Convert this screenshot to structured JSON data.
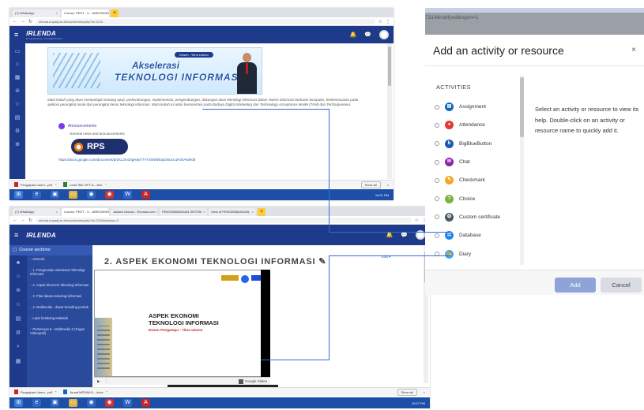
{
  "shot1": {
    "tabs": [
      {
        "label": "(7) WhatsApp"
      },
      {
        "label": "Course: PEET - 3 - JARKOMINT"
      }
    ],
    "url": "elenda.unpadj.ac.id/course/view.php?id=1234",
    "brand": "IRLENDA",
    "brand_sub": "E-LEARNING UNIVERSITAS",
    "banner": {
      "pill": "Dosen : Yitno Utomo",
      "line1": "Akselerasi",
      "line2": "TEKNOLOGI INFORMASI"
    },
    "description": "Mata kuliah yang akan mempelajari tentang awal, perkembangan, implementasi, pengembangan, dukungan akan teknologi informasi dalam sistem informasi berbasis komputer, berkesesuaian pada aplikasi perangkat lunak dan perangkat keras teknologi informasi. Mata kuliah ini akan berorientasi pada Budaya Digital Marketing dan Technology Acceptance Model (TAM) dan Technopreneur.",
    "announcements": "Announcements",
    "general": "General news and announcements",
    "rps": "RPS",
    "doc_link": "https://docs.google.com/document/d/1KL2m1hgHdyT7YVOWWb3pGkUoc1P2hAN/edit",
    "downloads": [
      {
        "label": "Pengajuan Usern...pdf"
      },
      {
        "label": "Lead Title UPT-IL...xlsx"
      }
    ],
    "show_all": "Show all",
    "clock": "10:01 PM"
  },
  "shot2": {
    "tabs": [
      {
        "label": "(7) WhatsApp"
      },
      {
        "label": "Course: PEET - 3 - JARKOMINT"
      },
      {
        "label": "Jadwal Liburan - Revalos.com"
      },
      {
        "label": "PENGEMBANGAN SISTEM"
      },
      {
        "label": "View of PENGEMBANGAN"
      }
    ],
    "url": "elenda.unpadj.ac.id/course/view.php?id=1234&section=2",
    "brand": "IRLENDA",
    "sidebar_head": "Course sections",
    "sections": [
      {
        "label": "General"
      },
      {
        "label": "1. Pengenalan Akselerasi Teknologi Informasi"
      },
      {
        "label": "2. Aspek Ekonomi Teknologi Informasi"
      },
      {
        "label": "3. Pilar dalam teknologi informasi"
      },
      {
        "label": "4. Multimedia - dasar branding produk"
      },
      {
        "label": "Latar belakang Makalah"
      },
      {
        "label": "Pertemuan 6 - Multimedia 2 (Tugas Videografi)"
      }
    ],
    "section_title": "2. ASPEK EKONOMI TEKNOLOGI INFORMASI",
    "edit": "Edit",
    "slide": {
      "title1": "ASPEK EKONOMI",
      "title2": "TEKNOLOGI INFORMASI",
      "author": "Dosen Pengampu : Yitno Utomo"
    },
    "slide_toolbar_text": "Google Slides",
    "downloads": [
      {
        "label": "Pengajuan Usern...pdf"
      },
      {
        "label": "Jurnal MPEAN1L...docx"
      }
    ],
    "show_all": "Show all",
    "clock": "10:07 PM"
  },
  "shot3": {
    "url_fragment": "73148notifyeditingon=1",
    "modal_title": "Add an activity or resource",
    "close": "×",
    "category": "ACTIVITIES",
    "activities": [
      {
        "label": "Assignment",
        "icon": "assignment-icon",
        "color": "#1565c0",
        "glyph": "▤"
      },
      {
        "label": "Attendance",
        "icon": "attendance-icon",
        "color": "#e53935",
        "glyph": "●"
      },
      {
        "label": "BigBlueButton",
        "icon": "bigbluebutton-icon",
        "color": "#1e5bb8",
        "glyph": "b"
      },
      {
        "label": "Chat",
        "icon": "chat-icon",
        "color": "#8e24aa",
        "glyph": "✉"
      },
      {
        "label": "Checkmark",
        "icon": "checkmark-icon",
        "color": "#f6a623",
        "glyph": "✎"
      },
      {
        "label": "Choice",
        "icon": "choice-icon",
        "color": "#7cb342",
        "glyph": "?"
      },
      {
        "label": "Custom certificate",
        "icon": "certificate-icon",
        "color": "#455a64",
        "glyph": "✪"
      },
      {
        "label": "Database",
        "icon": "database-icon",
        "color": "#1e88e5",
        "glyph": "☰"
      },
      {
        "label": "Diary",
        "icon": "diary-icon",
        "color": "#42a5f5",
        "glyph": "✍"
      }
    ],
    "help_text": "Select an activity or resource to view its help. Double-click on an activity or resource name to quickly add it.",
    "add_label": "Add",
    "cancel_label": "Cancel"
  }
}
